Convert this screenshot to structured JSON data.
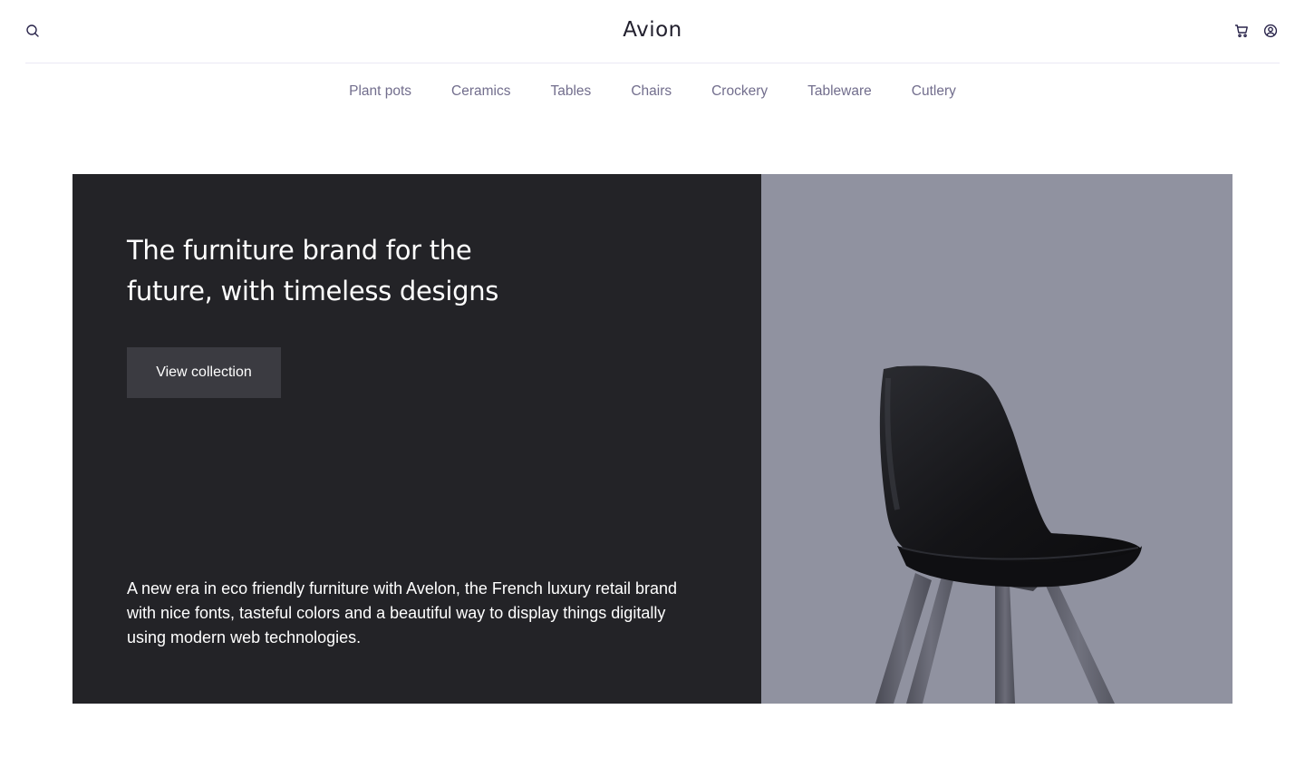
{
  "header": {
    "logo": "Avion",
    "icons": [
      "search-icon",
      "cart-icon",
      "user-icon"
    ]
  },
  "categories": [
    "Plant pots",
    "Ceramics",
    "Tables",
    "Chairs",
    "Crockery",
    "Tableware",
    "Cutlery"
  ],
  "hero": {
    "title": "The furniture brand for the future, with timeless designs",
    "cta_label": "View collection",
    "description": "A new era in eco friendly furniture with Avelon, the French luxury retail brand with nice fonts, tasteful colors and a beautiful way to display things digitally using modern web technologies.",
    "image": "black-chair-image"
  },
  "colors": {
    "hero_dark": "#232327",
    "hero_image_bg": "#9092a0",
    "cta_bg": "#3b3b41",
    "nav_text": "#726e8d",
    "divider": "#ebe8f4"
  }
}
